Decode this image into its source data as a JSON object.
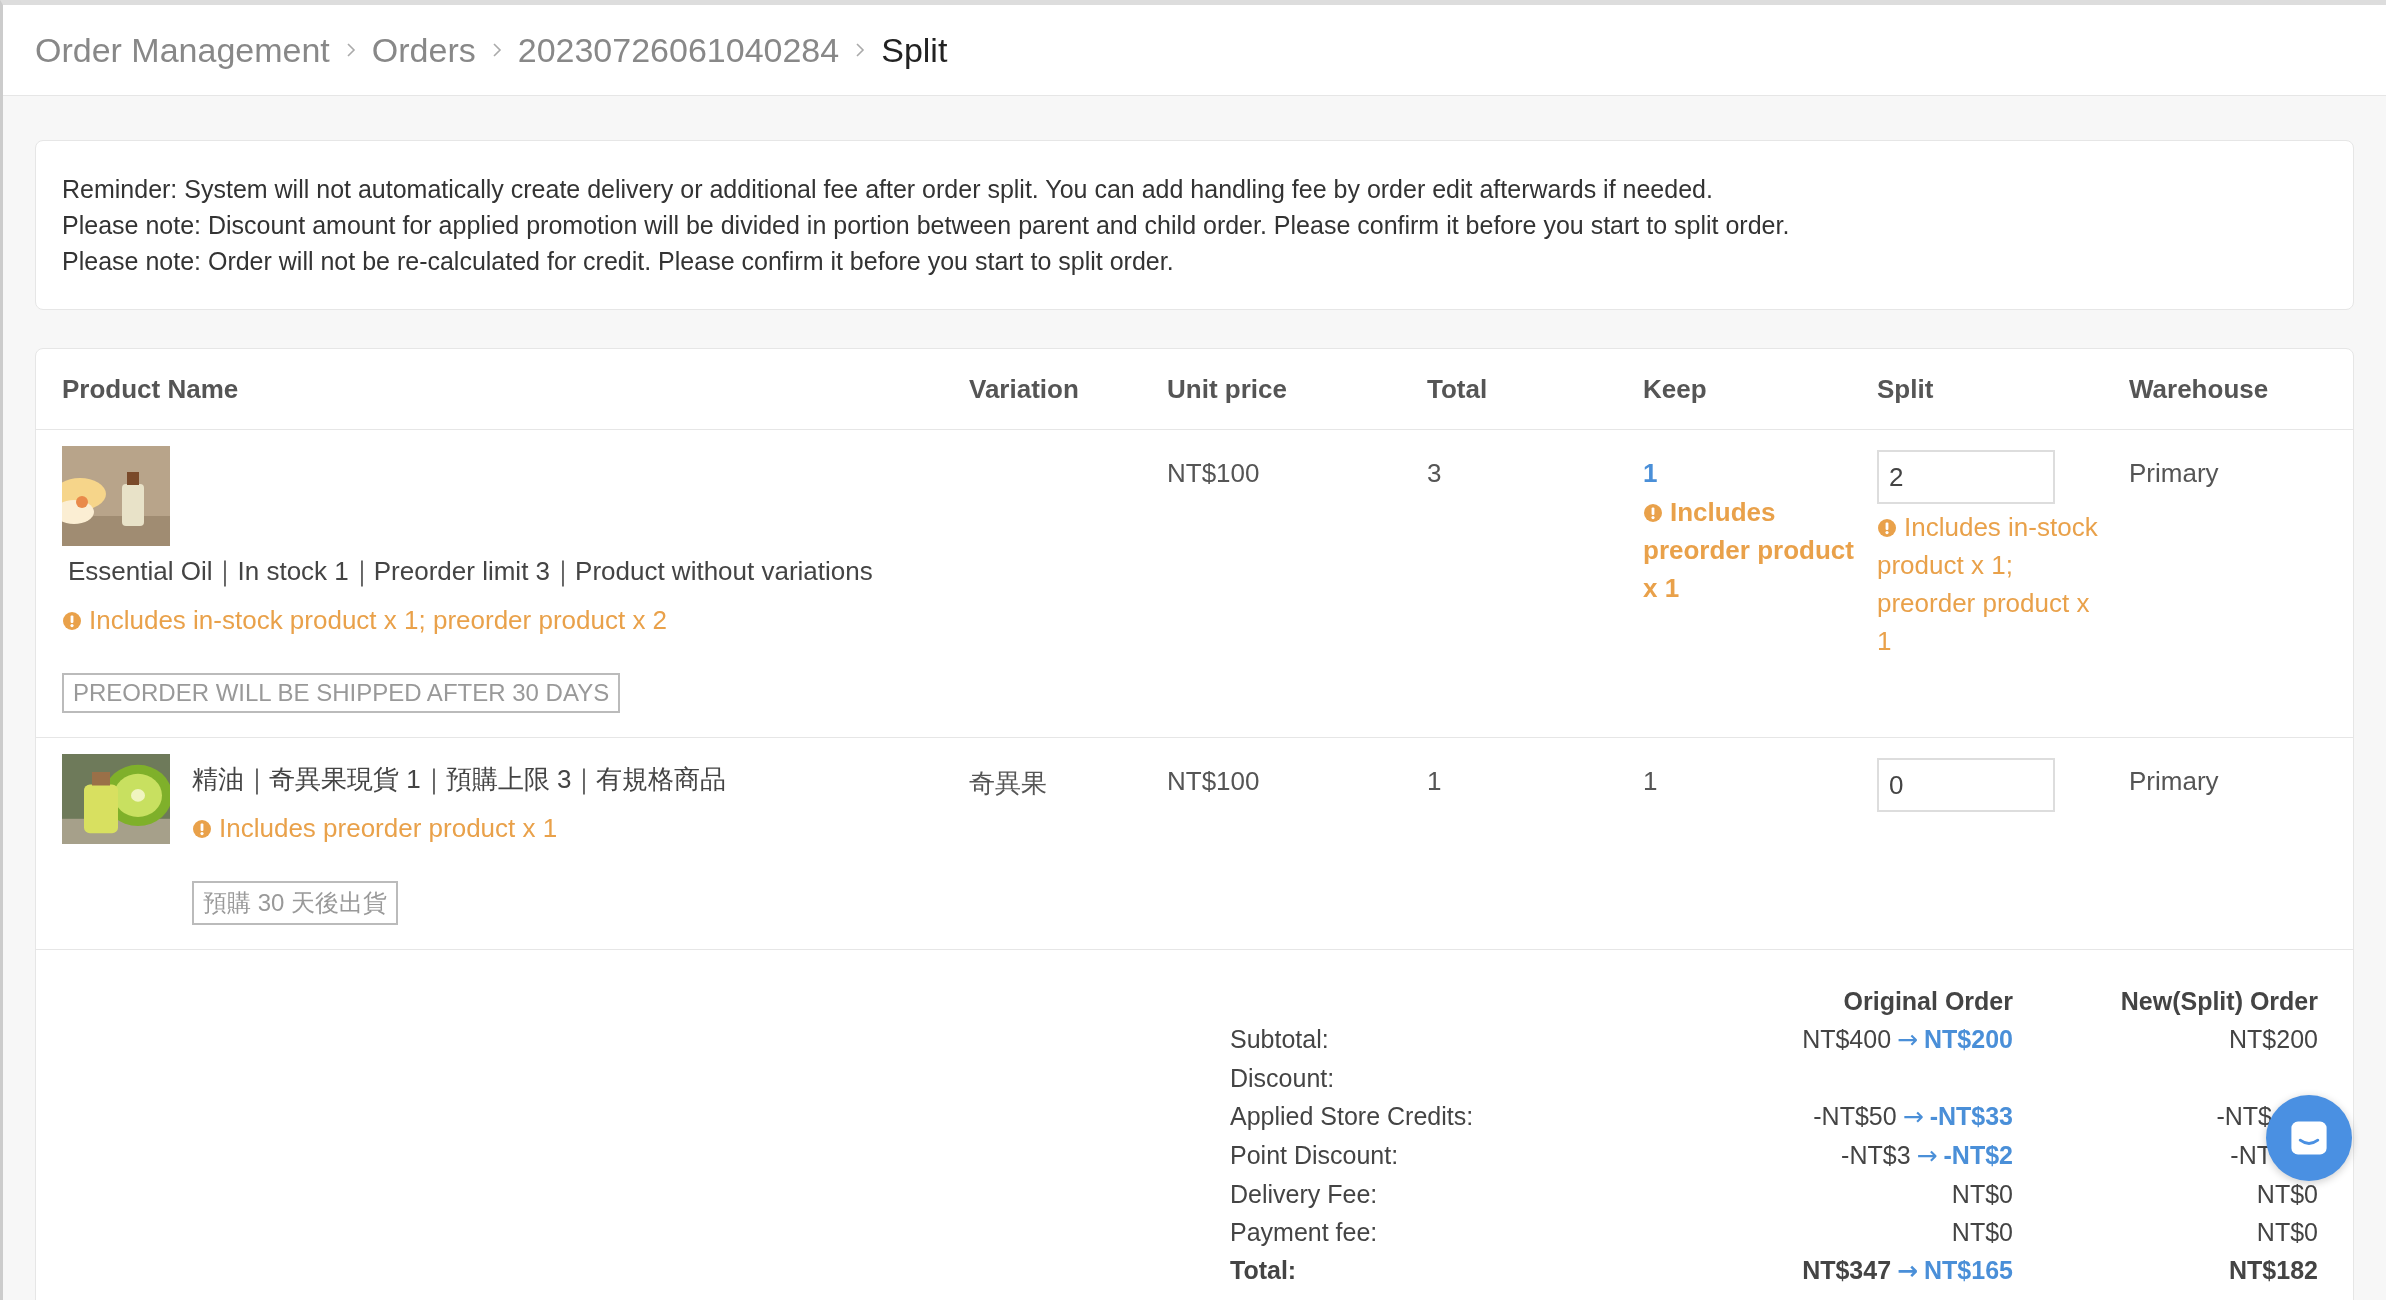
{
  "breadcrumb": [
    {
      "label": "Order Management",
      "current": false
    },
    {
      "label": "Orders",
      "current": false
    },
    {
      "label": "20230726061040284",
      "current": false
    },
    {
      "label": "Split",
      "current": true
    }
  ],
  "reminders": [
    "Reminder: System will not automatically create delivery or additional fee after order split. You can add handling fee by order edit afterwards if needed.",
    "Please note: Discount amount for applied promotion will be divided in portion between parent and child order. Please confirm it before you start to split order.",
    "Please note: Order will not be re-calculated for credit. Please confirm it before you start to split order."
  ],
  "table": {
    "columns": [
      "Product Name",
      "Variation",
      "Unit price",
      "Total",
      "Keep",
      "Split",
      "Warehouse"
    ],
    "rows": [
      {
        "kind": "stacked",
        "name": "Essential Oil｜In stock 1｜Preorder limit 3｜Product without variations",
        "note": "Includes in-stock product x 1; preorder product x 2",
        "tag": "PREORDER WILL BE SHIPPED AFTER 30 DAYS",
        "unit_price": "NT$100",
        "total": "3",
        "keep": "1",
        "keep_highlighted": true,
        "keep_note": "Includes preorder product x 1",
        "split": "2",
        "split_note": "Includes in-stock product x 1; preorder product x 1",
        "warehouse": "Primary"
      },
      {
        "kind": "beside",
        "name": "精油｜奇異果現貨 1｜預購上限 3｜有規格商品",
        "note": "Includes preorder product x 1",
        "tag": "預購 30 天後出貨",
        "variation": "奇異果",
        "unit_price": "NT$100",
        "total": "1",
        "keep": "1",
        "keep_highlighted": false,
        "split": "0",
        "warehouse": "Primary"
      }
    ]
  },
  "summary": {
    "headers": [
      "Original Order",
      "New(Split) Order"
    ],
    "rows": [
      {
        "label": "Subtotal:",
        "original": {
          "before": "NT$400",
          "arrow": "→",
          "after": "NT$200"
        },
        "split": "NT$200",
        "covered": false
      },
      {
        "label": "Discount:"
      },
      {
        "label": "Applied Store Credits:",
        "original": {
          "before": "-NT$50",
          "arrow": "→",
          "after": "-NT$33"
        },
        "split": "-NT$",
        "covered": true
      },
      {
        "label": "Point Discount:",
        "original": {
          "before": "-NT$3",
          "arrow": "→",
          "after": "-NT$2"
        },
        "split": "-NT",
        "covered": true
      },
      {
        "label": "Delivery Fee:",
        "original": {
          "before": "NT$0"
        },
        "split": "NT$0",
        "covered": false
      },
      {
        "label": "Payment fee:",
        "original": {
          "before": "NT$0"
        },
        "split": "NT$0",
        "covered": false
      },
      {
        "kind": "total",
        "label": "Total:",
        "original": {
          "before": "NT$347",
          "arrow": "→",
          "after": "NT$165"
        },
        "split": "NT$182",
        "covered": false
      }
    ]
  }
}
